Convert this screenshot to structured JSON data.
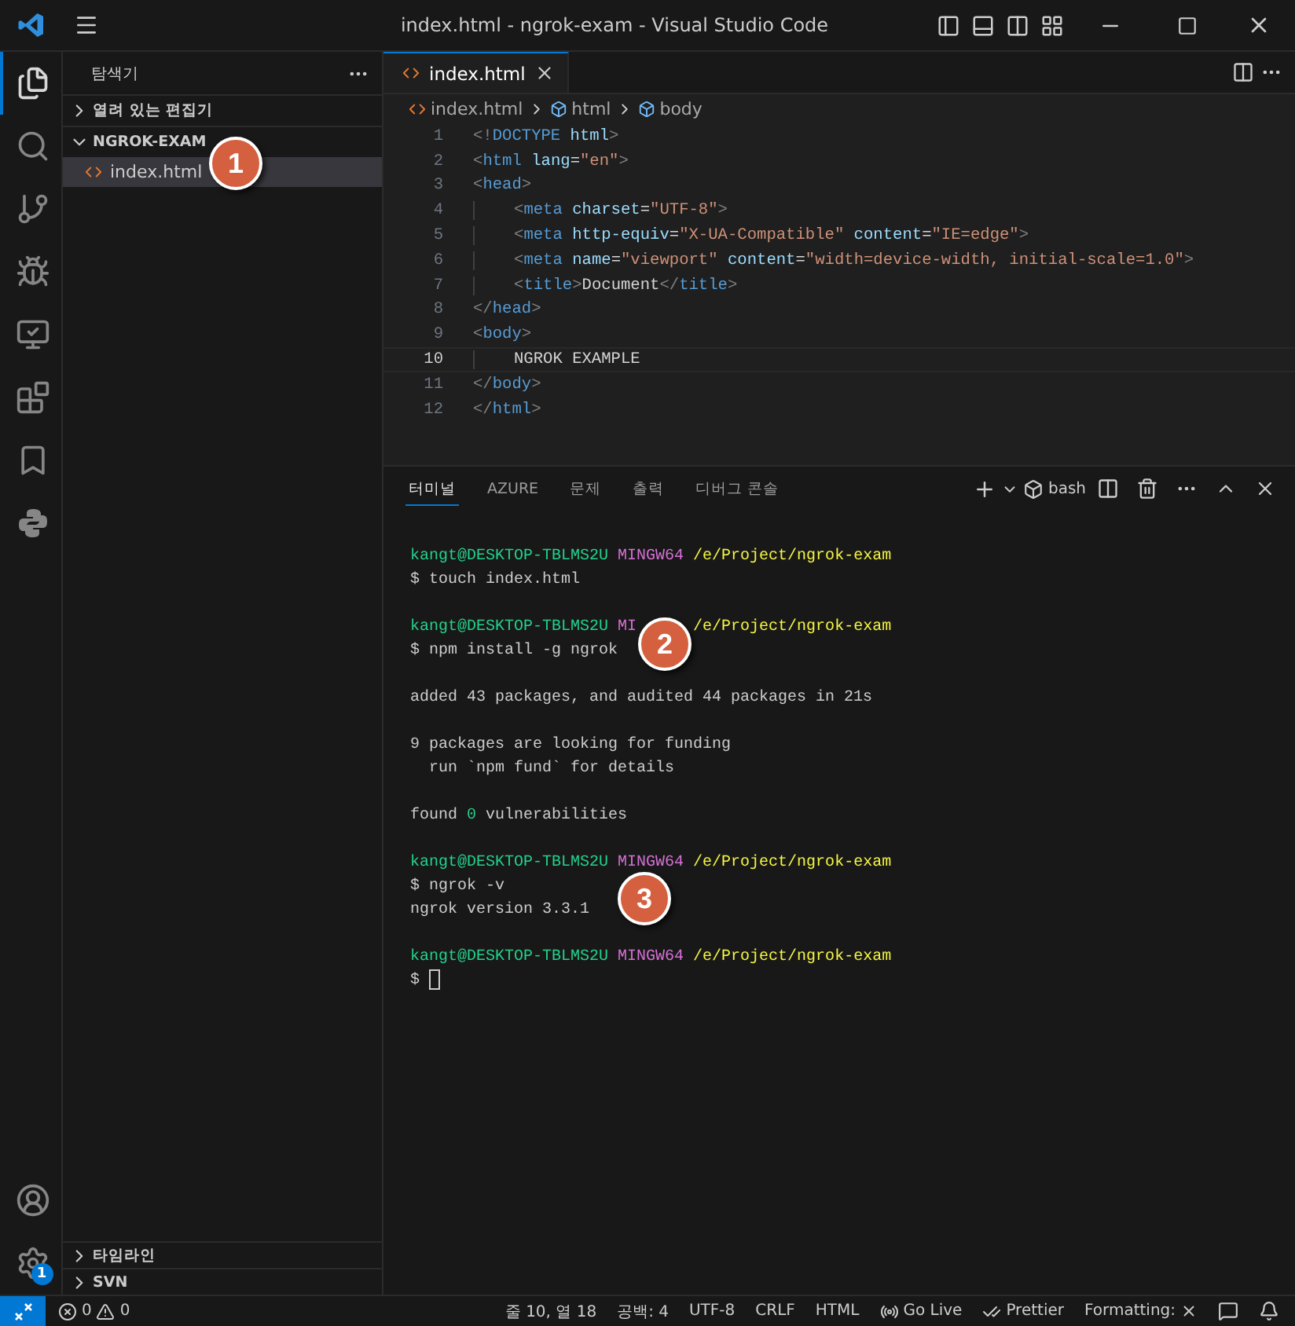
{
  "window": {
    "title": "index.html - ngrok-exam - Visual Studio Code"
  },
  "activity_bar": {
    "items": [
      {
        "kind": "files",
        "selected": true
      },
      {
        "kind": "search",
        "selected": false
      },
      {
        "kind": "git",
        "selected": false
      },
      {
        "kind": "debug",
        "selected": false
      },
      {
        "kind": "remote",
        "selected": false
      },
      {
        "kind": "extensions",
        "selected": false
      },
      {
        "kind": "bookmark",
        "selected": false
      },
      {
        "kind": "python",
        "selected": false
      }
    ],
    "settings_badge": "1"
  },
  "sidebar": {
    "title": "탐색기",
    "sections": [
      {
        "label": "열려 있는 편집기",
        "expanded": false
      },
      {
        "label": "NGROK-EXAM",
        "expanded": true,
        "files": [
          {
            "name": "index.html",
            "selected": true
          }
        ]
      }
    ],
    "bottom_sections": [
      {
        "label": "타임라인",
        "expanded": false
      },
      {
        "label": "SVN",
        "expanded": false
      }
    ]
  },
  "editor": {
    "tab": {
      "label": "index.html"
    },
    "breadcrumbs": [
      "index.html",
      "html",
      "body"
    ],
    "lines": [
      {
        "number": "1",
        "indented": false,
        "current": false,
        "tokens": [
          {
            "kind": "punct",
            "text": "<!"
          },
          {
            "kind": "tag",
            "text": "DOCTYPE"
          },
          {
            "kind": "attr",
            "text": " html"
          },
          {
            "kind": "punct",
            "text": ">"
          }
        ]
      },
      {
        "number": "2",
        "indented": false,
        "current": false,
        "tokens": [
          {
            "kind": "punct",
            "text": "<"
          },
          {
            "kind": "tag",
            "text": "html"
          },
          {
            "kind": "attr",
            "text": " lang"
          },
          {
            "kind": "text",
            "text": "="
          },
          {
            "kind": "string",
            "text": "\"en\""
          },
          {
            "kind": "punct",
            "text": ">"
          }
        ]
      },
      {
        "number": "3",
        "indented": false,
        "current": false,
        "tokens": [
          {
            "kind": "punct",
            "text": "<"
          },
          {
            "kind": "tag",
            "text": "head"
          },
          {
            "kind": "punct",
            "text": ">"
          }
        ]
      },
      {
        "number": "4",
        "indented": true,
        "current": false,
        "tokens": [
          {
            "kind": "punct",
            "text": "<"
          },
          {
            "kind": "tag",
            "text": "meta"
          },
          {
            "kind": "attr",
            "text": " charset"
          },
          {
            "kind": "text",
            "text": "="
          },
          {
            "kind": "string",
            "text": "\"UTF-8\""
          },
          {
            "kind": "punct",
            "text": ">"
          }
        ]
      },
      {
        "number": "5",
        "indented": true,
        "current": false,
        "tokens": [
          {
            "kind": "punct",
            "text": "<"
          },
          {
            "kind": "tag",
            "text": "meta"
          },
          {
            "kind": "attr",
            "text": " http-equiv"
          },
          {
            "kind": "text",
            "text": "="
          },
          {
            "kind": "string",
            "text": "\"X-UA-Compatible\""
          },
          {
            "kind": "attr",
            "text": " content"
          },
          {
            "kind": "text",
            "text": "="
          },
          {
            "kind": "string",
            "text": "\"IE=edge\""
          },
          {
            "kind": "punct",
            "text": ">"
          }
        ]
      },
      {
        "number": "6",
        "indented": true,
        "current": false,
        "tokens": [
          {
            "kind": "punct",
            "text": "<"
          },
          {
            "kind": "tag",
            "text": "meta"
          },
          {
            "kind": "attr",
            "text": " name"
          },
          {
            "kind": "text",
            "text": "="
          },
          {
            "kind": "string",
            "text": "\"viewport\""
          },
          {
            "kind": "attr",
            "text": " content"
          },
          {
            "kind": "text",
            "text": "="
          },
          {
            "kind": "string",
            "text": "\"width=device-width, initial-scale=1.0\""
          },
          {
            "kind": "punct",
            "text": ">"
          }
        ]
      },
      {
        "number": "7",
        "indented": true,
        "current": false,
        "tokens": [
          {
            "kind": "punct",
            "text": "<"
          },
          {
            "kind": "tag",
            "text": "title"
          },
          {
            "kind": "punct",
            "text": ">"
          },
          {
            "kind": "text",
            "text": "Document"
          },
          {
            "kind": "punct",
            "text": "</"
          },
          {
            "kind": "tag",
            "text": "title"
          },
          {
            "kind": "punct",
            "text": ">"
          }
        ]
      },
      {
        "number": "8",
        "indented": false,
        "current": false,
        "tokens": [
          {
            "kind": "punct",
            "text": "</"
          },
          {
            "kind": "tag",
            "text": "head"
          },
          {
            "kind": "punct",
            "text": ">"
          }
        ]
      },
      {
        "number": "9",
        "indented": false,
        "current": false,
        "tokens": [
          {
            "kind": "punct",
            "text": "<"
          },
          {
            "kind": "tag",
            "text": "body"
          },
          {
            "kind": "punct",
            "text": ">"
          }
        ]
      },
      {
        "number": "10",
        "indented": true,
        "current": true,
        "tokens": [
          {
            "kind": "text",
            "text": "NGROK EXAMPLE"
          }
        ]
      },
      {
        "number": "11",
        "indented": false,
        "current": false,
        "tokens": [
          {
            "kind": "punct",
            "text": "</"
          },
          {
            "kind": "tag",
            "text": "body"
          },
          {
            "kind": "punct",
            "text": ">"
          }
        ]
      },
      {
        "number": "12",
        "indented": false,
        "current": false,
        "tokens": [
          {
            "kind": "punct",
            "text": "</"
          },
          {
            "kind": "tag",
            "text": "html"
          },
          {
            "kind": "punct",
            "text": ">"
          }
        ]
      }
    ]
  },
  "panel": {
    "tabs": [
      {
        "label": "터미널",
        "selected": true
      },
      {
        "label": "AZURE",
        "selected": false
      },
      {
        "label": "문제",
        "selected": false
      },
      {
        "label": "출력",
        "selected": false
      },
      {
        "label": "디버그 콘솔",
        "selected": false
      }
    ],
    "shell": "bash",
    "terminal_blocks": [
      [
        [
          {
            "kind": "user",
            "text": "kangt@DESKTOP-TBLMS2U"
          },
          {
            "kind": "host",
            "text": " MINGW64"
          },
          {
            "kind": "path",
            "text": " /e/Project/ngrok-exam"
          }
        ],
        [
          {
            "kind": "plain",
            "text": "$ touch index.html"
          }
        ]
      ],
      [
        [
          {
            "kind": "user",
            "text": "kangt@DESKTOP-TBLMS2U"
          },
          {
            "kind": "host",
            "text": " MI",
            "covered_after": true
          },
          {
            "kind": "path",
            "text": " /e/Project/ngrok-exam"
          }
        ],
        [
          {
            "kind": "plain",
            "text": "$ npm install -g ngrok"
          }
        ]
      ],
      [
        [
          {
            "kind": "plain",
            "text": "added 43 packages, and audited 44 packages in 21s"
          }
        ]
      ],
      [
        [
          {
            "kind": "plain",
            "text": "9 packages are looking for funding"
          }
        ],
        [
          {
            "kind": "plain",
            "text": "  run `npm fund` for details"
          }
        ]
      ],
      [
        [
          {
            "kind": "plain",
            "text": "found "
          },
          {
            "kind": "number",
            "text": "0"
          },
          {
            "kind": "plain",
            "text": " vulnerabilities"
          }
        ]
      ],
      [
        [
          {
            "kind": "user",
            "text": "kangt@DESKTOP-TBLMS2U"
          },
          {
            "kind": "host",
            "text": " MINGW64"
          },
          {
            "kind": "path",
            "text": " /e/Project/ngrok-exam"
          }
        ],
        [
          {
            "kind": "plain",
            "text": "$ ngrok -v"
          }
        ],
        [
          {
            "kind": "plain",
            "text": "ngrok version 3.3.1"
          }
        ]
      ],
      [
        [
          {
            "kind": "user",
            "text": "kangt@DESKTOP-TBLMS2U"
          },
          {
            "kind": "host",
            "text": " MINGW64"
          },
          {
            "kind": "path",
            "text": " /e/Project/ngrok-exam"
          }
        ],
        [
          {
            "kind": "plain",
            "text": "$ "
          },
          {
            "kind": "cursor"
          }
        ]
      ]
    ]
  },
  "callouts": [
    {
      "label": "1"
    },
    {
      "label": "2"
    },
    {
      "label": "3"
    }
  ],
  "status_bar": {
    "errors": "0",
    "warnings": "0",
    "items": [
      {
        "kind": "text",
        "text": "줄 10, 열 18"
      },
      {
        "kind": "text",
        "text": "공백: 4"
      },
      {
        "kind": "text",
        "text": "UTF-8"
      },
      {
        "kind": "text",
        "text": "CRLF"
      },
      {
        "kind": "text",
        "text": "HTML"
      },
      {
        "kind": "golive",
        "text": "Go Live"
      },
      {
        "kind": "prettier",
        "text": "Prettier"
      },
      {
        "kind": "formatting",
        "text": "Formatting:"
      }
    ]
  }
}
